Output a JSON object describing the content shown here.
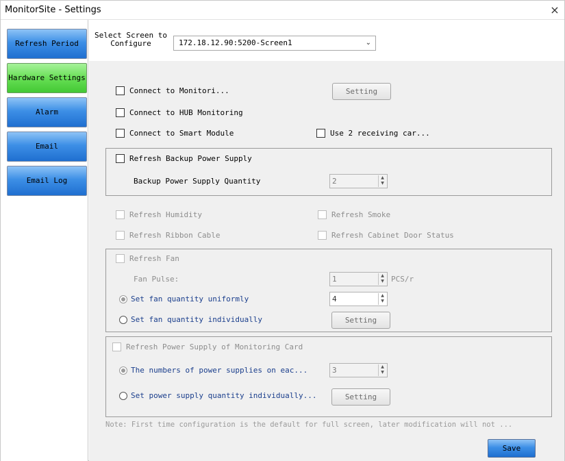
{
  "window": {
    "title": "MonitorSite - Settings",
    "close_glyph": "×"
  },
  "sidebar": {
    "items": [
      {
        "label": "Refresh Period",
        "active": false
      },
      {
        "label": "Hardware Settings",
        "active": true
      },
      {
        "label": "Alarm",
        "active": false
      },
      {
        "label": "Email",
        "active": false
      },
      {
        "label": "Email Log",
        "active": false
      }
    ]
  },
  "screen_select": {
    "label": "Select Screen to Configure",
    "value": "172.18.12.90:5200-Screen1",
    "arrow_icon": "chevron-down-icon"
  },
  "hardware": {
    "connect_monitoring": {
      "label": "Connect to Monitori...",
      "checked": false
    },
    "monitoring_setting_button": "Setting",
    "connect_hub": {
      "label": "Connect to HUB Monitoring",
      "checked": false
    },
    "connect_smart": {
      "label": "Connect to Smart Module",
      "checked": false
    },
    "use_receiving": {
      "label": "Use 2 receiving car...",
      "checked": false
    },
    "backup_power": {
      "label": "Refresh Backup Power Supply",
      "checked": false,
      "quantity_label": "Backup Power Supply Quantity",
      "quantity_value": "2"
    },
    "humidity": {
      "label": "Refresh Humidity",
      "checked": false
    },
    "smoke": {
      "label": "Refresh Smoke",
      "checked": false
    },
    "ribbon": {
      "label": "Refresh Ribbon Cable",
      "checked": false
    },
    "cabinet_door": {
      "label": "Refresh Cabinet Door Status",
      "checked": false
    },
    "fan": {
      "label": "Refresh Fan",
      "checked": false,
      "pulse_label": "Fan Pulse:",
      "pulse_value": "1",
      "pulse_unit": "PCS/r",
      "uniform_label": "Set fan quantity uniformly",
      "uniform_checked": true,
      "uniform_value": "4",
      "individual_label": "Set fan quantity individually",
      "individual_checked": false,
      "setting_button": "Setting"
    },
    "power_card": {
      "label": "Refresh Power Supply of Monitoring Card",
      "checked": false,
      "numbers_label": "The numbers of power supplies on eac...",
      "numbers_checked": true,
      "numbers_value": "3",
      "individual_label": "Set power supply quantity individually...",
      "individual_checked": false,
      "setting_button": "Setting"
    },
    "note": "Note: First time configuration is the default for full screen, later modification will not ...",
    "save_button": "Save"
  },
  "colors": {
    "nav_blue": "#3d8fe6",
    "nav_active_green": "#67df55",
    "disabled_text": "#8d8d8d",
    "radio_label_blue": "#1a3e8c"
  }
}
